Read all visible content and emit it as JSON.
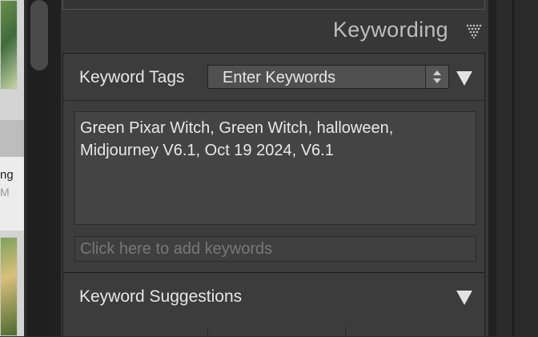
{
  "filmstrip": {
    "partial_label": "ng",
    "partial_sublabel": "M"
  },
  "keywording": {
    "section_title": "Keywording",
    "keyword_tags": {
      "label": "Keyword Tags",
      "mode_selected": "Enter Keywords",
      "keywords_text": "Green Pixar Witch, Green Witch, halloween, Midjourney V6.1, Oct 19 2024, V6.1",
      "add_placeholder": "Click here to add keywords"
    },
    "suggestions": {
      "label": "Keyword Suggestions"
    }
  },
  "icons": {
    "panel_menu": "dotted-triangle-icon",
    "collapse": "triangle-down-icon",
    "select_arrows": "up-down-arrows-icon"
  }
}
